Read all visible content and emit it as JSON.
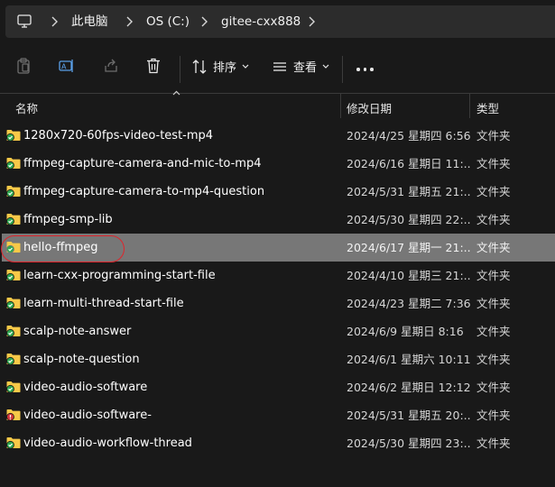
{
  "address_bar": {
    "icon": "this-pc-icon",
    "crumbs": [
      "此电脑",
      "OS (C:)",
      "gitee-cxx888"
    ]
  },
  "toolbar": {
    "sort_label": "排序",
    "view_label": "查看"
  },
  "columns": {
    "name": "名称",
    "modified": "修改日期",
    "type": "类型"
  },
  "files": [
    {
      "name": "1280x720-60fps-video-test-mp4",
      "modified": "2024/4/25 星期四 6:56",
      "type": "文件夹",
      "status": "synced"
    },
    {
      "name": "ffmpeg-capture-camera-and-mic-to-mp4",
      "modified": "2024/6/16 星期日 11:...",
      "type": "文件夹",
      "status": "synced"
    },
    {
      "name": "ffmpeg-capture-camera-to-mp4-question",
      "modified": "2024/5/31 星期五 21:...",
      "type": "文件夹",
      "status": "synced"
    },
    {
      "name": "ffmpeg-smp-lib",
      "modified": "2024/5/30 星期四 22:...",
      "type": "文件夹",
      "status": "synced"
    },
    {
      "name": "hello-ffmpeg",
      "modified": "2024/6/17 星期一 21:...",
      "type": "文件夹",
      "status": "synced",
      "selected": true
    },
    {
      "name": "learn-cxx-programming-start-file",
      "modified": "2024/4/10 星期三 21:...",
      "type": "文件夹",
      "status": "synced"
    },
    {
      "name": "learn-multi-thread-start-file",
      "modified": "2024/4/23 星期二 7:36",
      "type": "文件夹",
      "status": "synced"
    },
    {
      "name": "scalp-note-answer",
      "modified": "2024/6/9 星期日 8:16",
      "type": "文件夹",
      "status": "synced"
    },
    {
      "name": "scalp-note-question",
      "modified": "2024/6/1 星期六 10:11",
      "type": "文件夹",
      "status": "synced"
    },
    {
      "name": "video-audio-software",
      "modified": "2024/6/2 星期日 12:12",
      "type": "文件夹",
      "status": "synced"
    },
    {
      "name": "video-audio-software-",
      "modified": "2024/5/31 星期五 20:...",
      "type": "文件夹",
      "status": "error"
    },
    {
      "name": "video-audio-workflow-thread",
      "modified": "2024/5/30 星期四 23:...",
      "type": "文件夹",
      "status": "synced"
    }
  ],
  "colors": {
    "background": "#191919",
    "selection": "#777777",
    "folder": "#f7c948",
    "synced_badge": "#2fa84f",
    "error_badge": "#d13438",
    "annotation_ring": "#e0242b"
  }
}
